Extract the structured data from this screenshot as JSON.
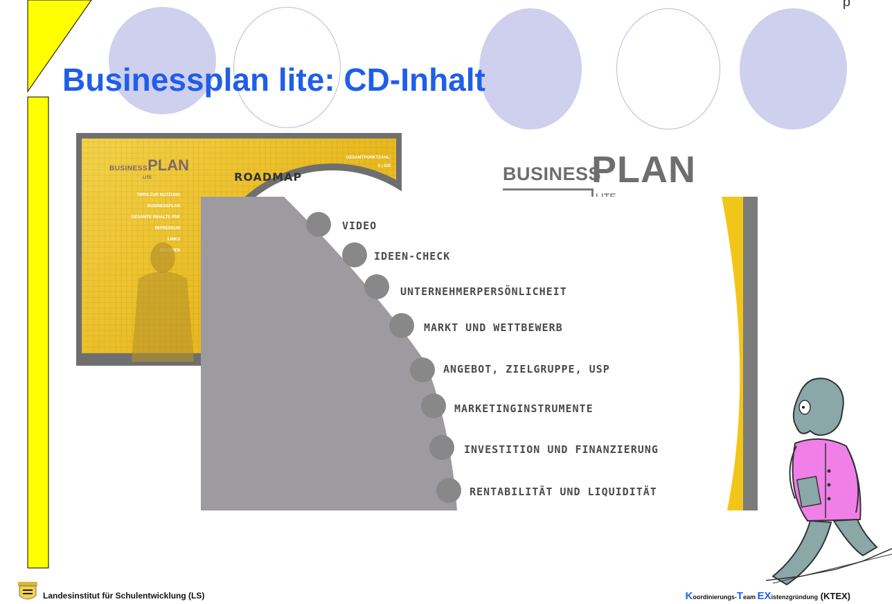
{
  "slide": {
    "title": "Businessplan lite: CD-Inhalt",
    "page_number": "p"
  },
  "background_screenshot": {
    "logo_business": "BUSINESS",
    "logo_plan": "PLAN",
    "logo_lite": "LITE",
    "gesamt_label": "GESAMTPUNKTZAHL:",
    "gesamt_value": "0 | 100",
    "roadmap_title": "ROADMAP",
    "menu": [
      "TIPPS ZUR NUTZUNG",
      "BUSINESSPLAN",
      "GESAMTE INHALTE PDF",
      "IMPRESSUM",
      "LINKS",
      "BEENDEN"
    ]
  },
  "logo": {
    "business": "BUSINESS",
    "plan": "PLAN",
    "lite": "LITE"
  },
  "roadmap_items": [
    "VIDEO",
    "IDEEN-CHECK",
    "UNTERNEHMERPERSÖNLICHEIT",
    "MARKT UND WETTBEWERB",
    "ANGEBOT, ZIELGRUPPE, USP",
    "MARKETINGINSTRUMENTE",
    "INVESTITION UND FINANZIERUNG",
    "RENTABILITÄT UND LIQUIDITÄT"
  ],
  "footer": {
    "left_text": "Landesinstitut für Schulentwicklung  (LS)",
    "right_k": "K",
    "right_k_rest": "oordinierungs-",
    "right_t": "T",
    "right_t_rest": "eam ",
    "right_ex": "EX",
    "right_ex_rest": "istenzgründung",
    "right_suffix": " (KTEX)"
  },
  "colors": {
    "title_blue": "#1f5fe8",
    "deco_yellow": "#ffff00",
    "circle_lavender": "#cfcfee",
    "roadmap_gray": "#9d9b9f",
    "shot_yellow": "#f0c73a",
    "cartoon_pink": "#f080e8",
    "cartoon_teal": "#8aa8a8"
  }
}
